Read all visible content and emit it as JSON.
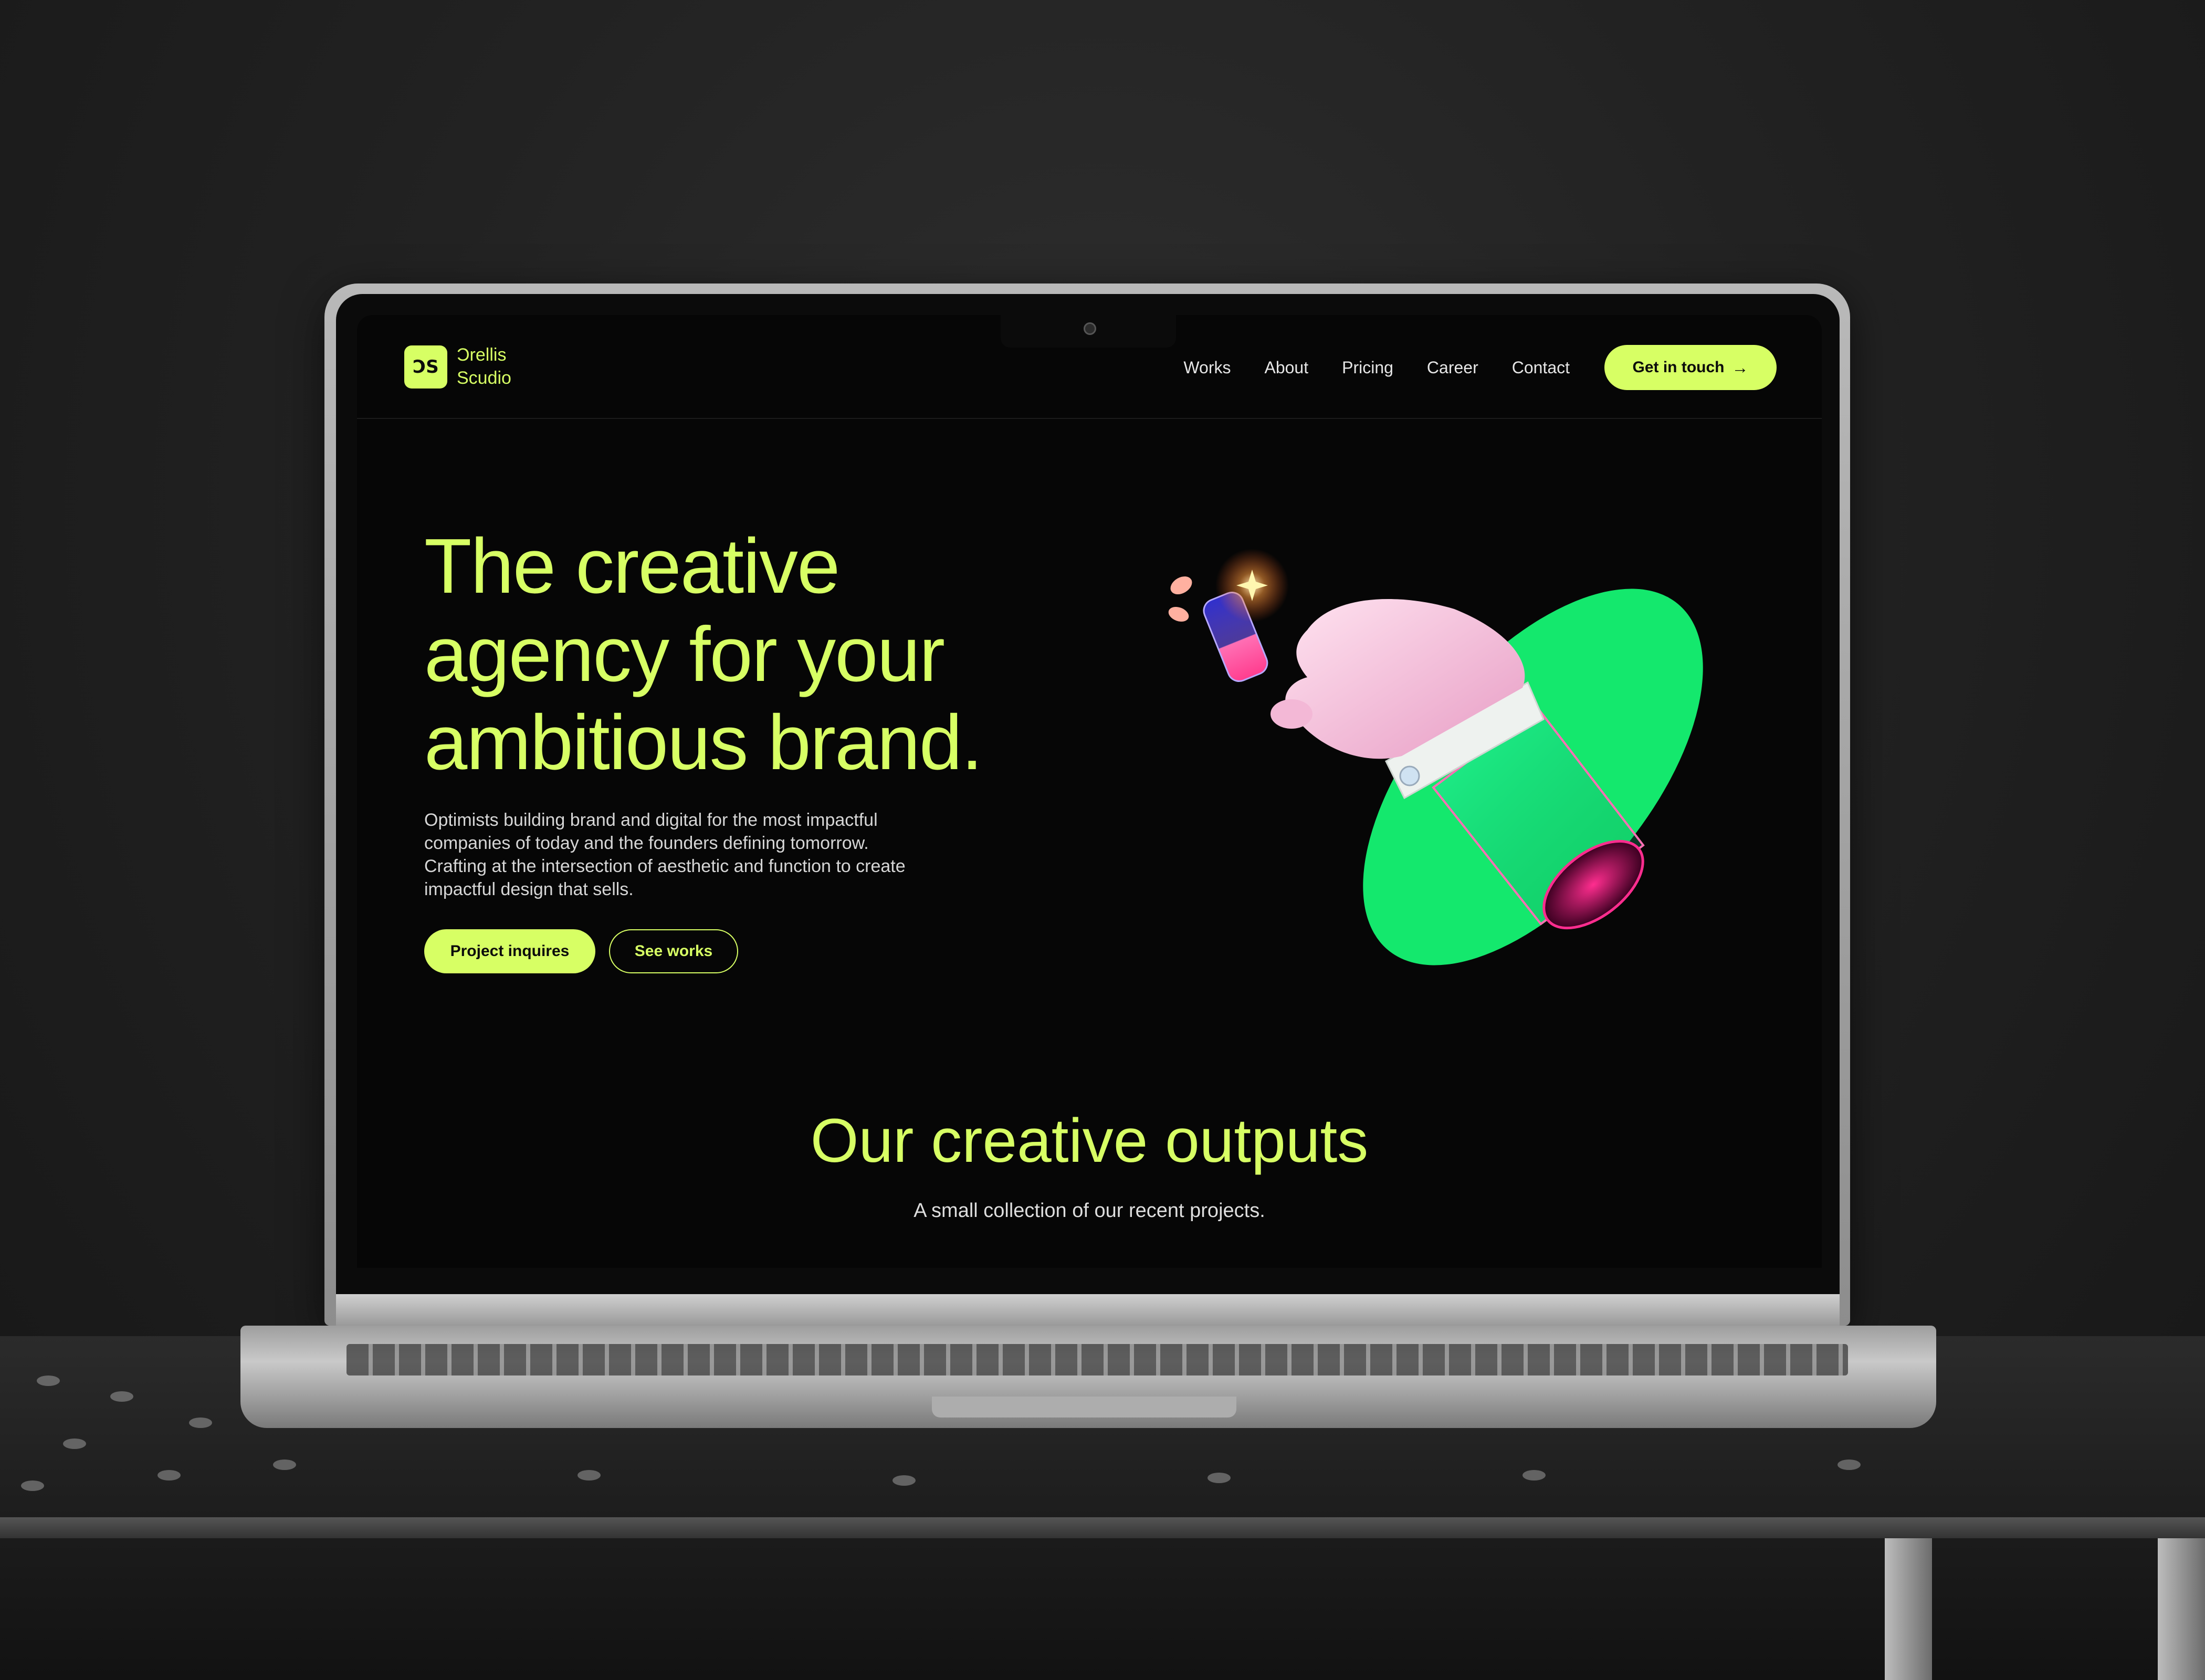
{
  "brand": {
    "mark": "ƆS",
    "name_line1": "Ͻrellis",
    "name_line2": "Sϲudio"
  },
  "nav": {
    "links": [
      "Works",
      "About",
      "Pricing",
      "Career",
      "Contact"
    ],
    "cta_label": "Get in touch",
    "cta_icon": "arrow-right-icon"
  },
  "hero": {
    "title_lines": [
      "The creative",
      "agency for your",
      "ambitious brand."
    ],
    "subtitle": "Optimists building brand and digital for the most impactful companies of today and the founders defining tomorrow. Crafting at the intersection of aesthetic and function to create impactful design that sells.",
    "primary_button": "Project inquires",
    "secondary_button": "See works",
    "illustration": "hand-holding-glass-illustration"
  },
  "outputs": {
    "title": "Our creative outputs",
    "subtitle": "A small collection of our recent projects."
  },
  "colors": {
    "accent": "#d7ff64",
    "screen_bg": "#060606",
    "ellipse_green": "#14e86d",
    "hand_pink": "#f7c6df",
    "magenta": "#ff2d8f"
  }
}
